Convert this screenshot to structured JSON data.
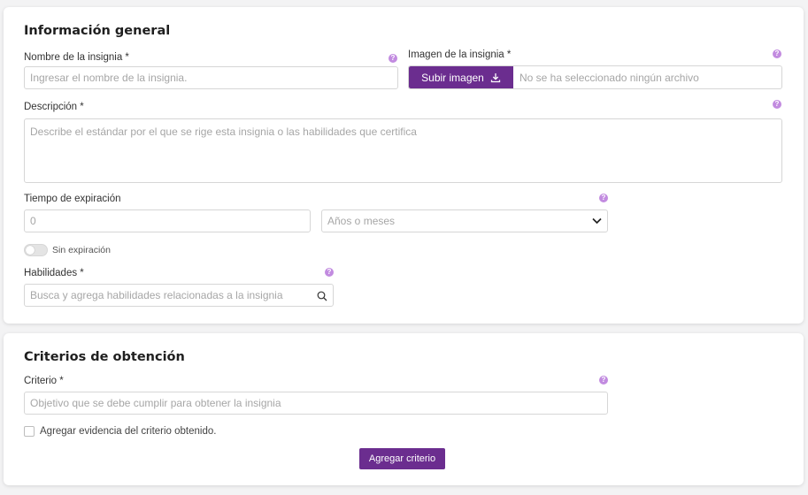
{
  "general": {
    "title": "Información general",
    "badge_name": {
      "label": "Nombre de la insignia *",
      "placeholder": "Ingresar el nombre de la insignia."
    },
    "badge_image": {
      "label": "Imagen de la insignia *",
      "upload_label": "Subir imagen",
      "file_status": "No se ha seleccionado ningún archivo"
    },
    "description": {
      "label": "Descripción *",
      "placeholder": "Describe el estándar por el que se rige esta insignia o las habilidades que certifica"
    },
    "expiration": {
      "label": "Tiempo de expiración",
      "amount_placeholder": "0",
      "unit_placeholder": "Años o meses",
      "no_expiration_label": "Sin expiración"
    },
    "skills": {
      "label": "Habilidades *",
      "placeholder": "Busca y agrega habilidades relacionadas a la insignia"
    },
    "help_glyph": "?"
  },
  "criteria": {
    "title": "Criterios de obtención",
    "criterion": {
      "label": "Criterio *",
      "placeholder": "Objetivo que se debe cumplir para obtener la insignia"
    },
    "evidence_label": "Agregar evidencia del criterio obtenido.",
    "add_button": "Agregar criterio"
  },
  "colors": {
    "accent": "#6b2d8f",
    "help_icon": "#c28be0"
  },
  "icons": {
    "upload": "download-icon",
    "select": "chevron-down-icon",
    "search": "search-icon",
    "help": "help-icon"
  }
}
